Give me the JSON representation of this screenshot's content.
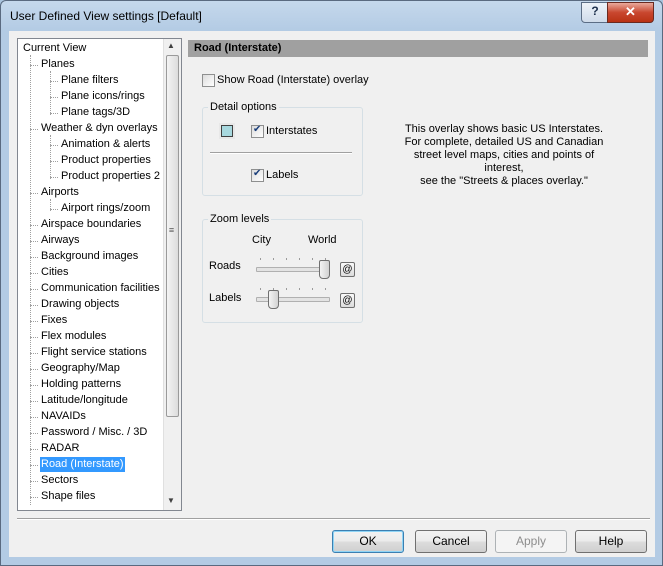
{
  "window": {
    "title": "User Defined View settings  [Default]",
    "help_glyph": "?",
    "close_glyph": "✕"
  },
  "tree": {
    "items": [
      {
        "label": "Current View",
        "level": 0
      },
      {
        "label": "Planes",
        "level": 1
      },
      {
        "label": "Plane filters",
        "level": 2
      },
      {
        "label": "Plane icons/rings",
        "level": 2
      },
      {
        "label": "Plane tags/3D",
        "level": 2
      },
      {
        "label": "Weather & dyn overlays",
        "level": 1
      },
      {
        "label": "Animation & alerts",
        "level": 2
      },
      {
        "label": "Product properties",
        "level": 2
      },
      {
        "label": "Product properties 2",
        "level": 2
      },
      {
        "label": "Airports",
        "level": 1
      },
      {
        "label": "Airport rings/zoom",
        "level": 2
      },
      {
        "label": "Airspace boundaries",
        "level": 1
      },
      {
        "label": "Airways",
        "level": 1
      },
      {
        "label": "Background images",
        "level": 1
      },
      {
        "label": "Cities",
        "level": 1
      },
      {
        "label": "Communication facilities",
        "level": 1
      },
      {
        "label": "Drawing objects",
        "level": 1
      },
      {
        "label": "Fixes",
        "level": 1
      },
      {
        "label": "Flex modules",
        "level": 1
      },
      {
        "label": "Flight service stations",
        "level": 1
      },
      {
        "label": "Geography/Map",
        "level": 1
      },
      {
        "label": "Holding patterns",
        "level": 1
      },
      {
        "label": "Latitude/longitude",
        "level": 1
      },
      {
        "label": "NAVAIDs",
        "level": 1
      },
      {
        "label": "Password / Misc. / 3D",
        "level": 1
      },
      {
        "label": "RADAR",
        "level": 1
      },
      {
        "label": "Road (Interstate)",
        "level": 1,
        "selected": true
      },
      {
        "label": "Sectors",
        "level": 1
      },
      {
        "label": "Shape files",
        "level": 1
      }
    ],
    "scroll_up_glyph": "▲",
    "scroll_down_glyph": "▼",
    "grip_glyph": "≡"
  },
  "panel": {
    "header": "Road (Interstate)",
    "show_overlay": {
      "label": "Show Road (Interstate) overlay",
      "checked": false
    },
    "detail_options": {
      "title": "Detail options",
      "color_swatch": "#a7d8de",
      "interstates": {
        "label": "Interstates",
        "checked": true
      },
      "labels": {
        "label": "Labels",
        "checked": true
      }
    },
    "description": [
      "This overlay shows basic US Interstates.",
      "For complete, detailed US and Canadian",
      "street level maps, cities and points of interest,",
      "see the \"Streets & places overlay.\""
    ],
    "zoom_levels": {
      "title": "Zoom levels",
      "col_city": "City",
      "col_world": "World",
      "rows": [
        {
          "label": "Roads",
          "level": 1.0,
          "button_glyph": "@"
        },
        {
          "label": "Labels",
          "level": 0.2,
          "button_glyph": "@"
        }
      ]
    }
  },
  "buttons": {
    "ok": "OK",
    "cancel": "Cancel",
    "apply": "Apply",
    "help": "Help"
  }
}
